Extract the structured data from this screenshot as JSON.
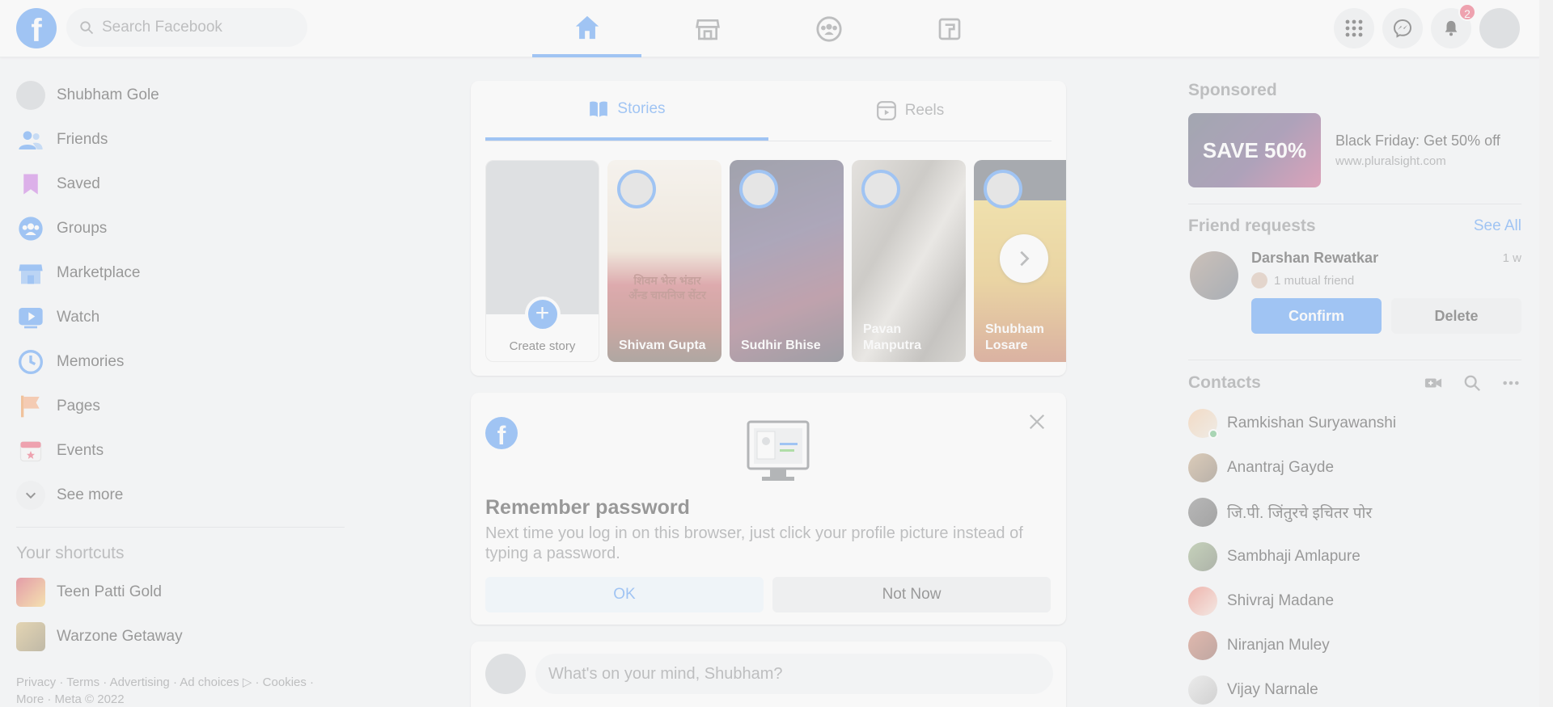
{
  "header": {
    "search_placeholder": "Search Facebook",
    "notification_count": "2",
    "nav_tabs": [
      "home",
      "marketplace",
      "groups",
      "gaming"
    ]
  },
  "sidebar": {
    "items": [
      {
        "label": "Shubham Gole",
        "icon": "avatar"
      },
      {
        "label": "Friends",
        "icon": "friends-icon"
      },
      {
        "label": "Saved",
        "icon": "bookmark-icon"
      },
      {
        "label": "Groups",
        "icon": "groups-icon"
      },
      {
        "label": "Marketplace",
        "icon": "store-icon"
      },
      {
        "label": "Watch",
        "icon": "watch-icon"
      },
      {
        "label": "Memories",
        "icon": "clock-icon"
      },
      {
        "label": "Pages",
        "icon": "flag-icon"
      },
      {
        "label": "Events",
        "icon": "calendar-icon"
      },
      {
        "label": "See more",
        "icon": "chevron-down-icon"
      }
    ],
    "shortcuts_title": "Your shortcuts",
    "shortcuts": [
      {
        "label": "Teen Patti Gold"
      },
      {
        "label": "Warzone Getaway"
      }
    ],
    "footer_line1": "Privacy · Terms · Advertising · Ad choices ▷ · Cookies ·",
    "footer_line2": "More · Meta © 2022"
  },
  "stories_card": {
    "tab_stories": "Stories",
    "tab_reels": "Reels",
    "create_story": "Create story",
    "stories": [
      {
        "name": "Shivam Gupta"
      },
      {
        "name": "Sudhir Bhise"
      },
      {
        "name": "Pavan Manputra"
      },
      {
        "name": "Shubham Losare"
      }
    ],
    "story1_sign_text": "शिवम भेल भंडार अँन्ड चायनिज सेंटर"
  },
  "password_card": {
    "title": "Remember password",
    "body": "Next time you log in on this browser, just click your profile picture instead of typing a password.",
    "ok": "OK",
    "not_now": "Not Now"
  },
  "composer": {
    "placeholder": "What's on your mind, Shubham?"
  },
  "right": {
    "sponsored_title": "Sponsored",
    "ad_title": "Black Friday: Get 50% off",
    "ad_url": "www.pluralsight.com",
    "ad_image_text": "SAVE 50%",
    "friend_requests_title": "Friend requests",
    "see_all": "See All",
    "request_name": "Darshan Rewatkar",
    "request_time": "1 w",
    "mutual": "1 mutual friend",
    "confirm": "Confirm",
    "delete": "Delete",
    "contacts_title": "Contacts",
    "contacts": [
      {
        "name": "Ramkishan Suryawanshi"
      },
      {
        "name": "Anantraj Gayde"
      },
      {
        "name": "जि.पी. जिंतुरचे इचितर पोर"
      },
      {
        "name": "Sambhaji Amlapure"
      },
      {
        "name": "Shivraj Madane"
      },
      {
        "name": "Niranjan Muley"
      },
      {
        "name": "Vijay Narnale"
      }
    ]
  },
  "colors": {
    "brand": "#1877f2",
    "background": "#f0f2f5",
    "badge": "#e41e3f"
  }
}
